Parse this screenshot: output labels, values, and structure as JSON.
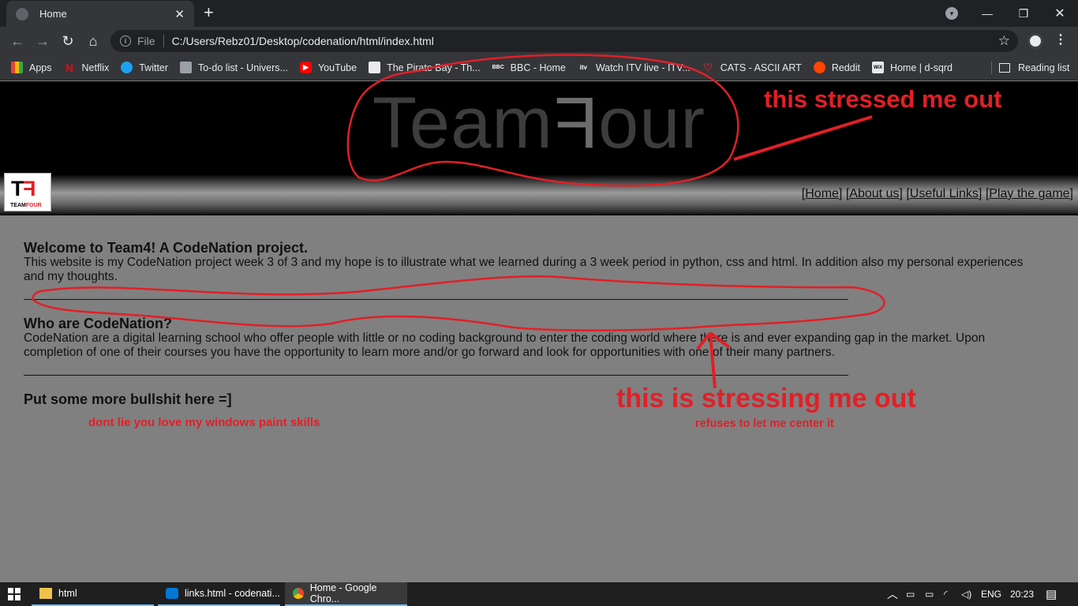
{
  "browser": {
    "tab_title": "Home",
    "url_scheme": "File",
    "url": "C:/Users/Rebz01/Desktop/codenation/html/index.html",
    "bookmarks": [
      "Apps",
      "Netflix",
      "Twitter",
      "To-do list - Univers...",
      "YouTube",
      "The Pirate Bay - Th...",
      "BBC - Home",
      "Watch ITV live - ITV...",
      "CATS - ASCII ART",
      "Reddit",
      "Home | d-sqrd"
    ],
    "reading_list": "Reading list"
  },
  "site": {
    "logo_text_a": "Team",
    "logo_text_f": "F",
    "logo_text_b": "our",
    "badge_mark_a": "T",
    "badge_mark_b": "F",
    "badge_name_a": "TEAM",
    "badge_name_b": "FOUR",
    "nav": [
      "Home",
      "About us",
      "Useful Links",
      "Play the game"
    ],
    "sections": [
      {
        "heading": "Welcome to Team4! A CodeNation project.",
        "body": "This website is my CodeNation project week 3 of 3 and my hope is to illustrate what we learned during a 3 week period in python, css and html. In addition also my personal experiences and my thoughts."
      },
      {
        "heading": "Who are CodeNation?",
        "body": "CodeNation are a digital learning school who offer people with little or no coding background to enter the coding world where there is and ever expanding gap in the market. Upon completion of one of their courses you have the opportunity to learn more and/or go forward and look for opportunities with one of their many partners."
      },
      {
        "heading": "Put some more bullshit here =]"
      }
    ]
  },
  "annotations": {
    "stressed": "this stressed me out",
    "stressing": "this is stressing me out",
    "center": "refuses to let me center it",
    "paint": "dont lie  you love my windows paint skills"
  },
  "taskbar": {
    "items": [
      "html",
      "links.html - codenati...",
      "Home - Google Chro..."
    ],
    "language": "ENG",
    "time": "20:23"
  }
}
